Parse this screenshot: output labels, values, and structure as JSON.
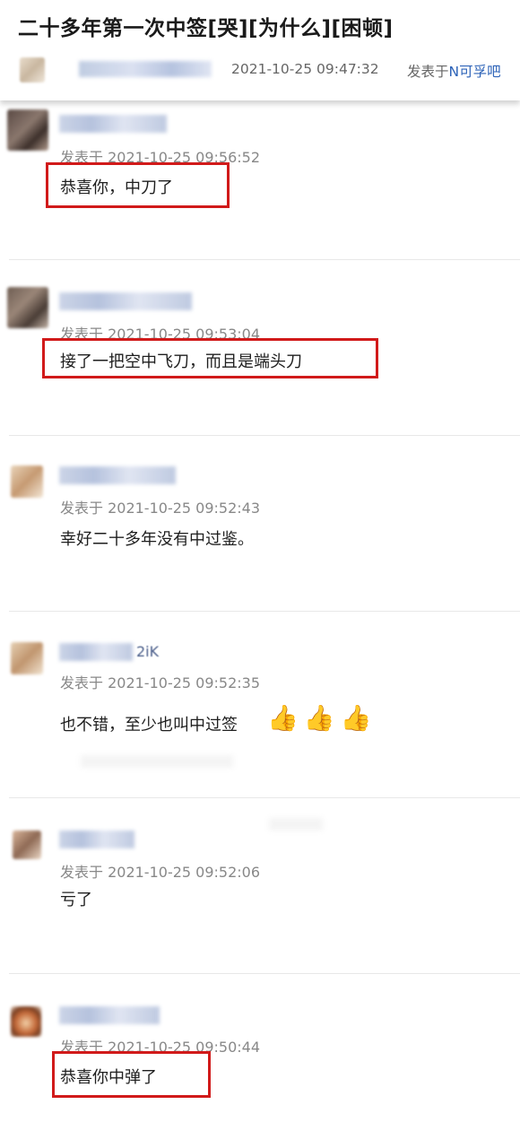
{
  "post": {
    "title": "二十多年第一次中签[哭][为什么][困顿]",
    "time": "2021-10-25 09:47:32",
    "posted_in_prefix": "发表于",
    "forum": "N可孚吧"
  },
  "comments": [
    {
      "name_tail": "",
      "time": "发表于 2021-10-25 09:56:52",
      "text": "恭喜你，中刀了",
      "highlighted": true
    },
    {
      "name_tail": "",
      "time": "发表于 2021-10-25 09:53:04",
      "text": "接了一把空中飞刀，而且是端头刀",
      "highlighted": true
    },
    {
      "name_tail": "",
      "time": "发表于 2021-10-25 09:52:43",
      "text": "幸好二十多年没有中过鉴。",
      "highlighted": false
    },
    {
      "name_tail": "2iK",
      "time": "发表于 2021-10-25 09:52:35",
      "text": "也不错，至少也叫中过签",
      "thumbs": "👍👍👍",
      "highlighted": false
    },
    {
      "name_tail": "",
      "time": "发表于 2021-10-25 09:52:06",
      "text": "亏了",
      "highlighted": false
    },
    {
      "name_tail": "",
      "time": "发表于 2021-10-25 09:50:44",
      "text": "恭喜你中弹了",
      "highlighted": true
    }
  ],
  "colors": {
    "highlight": "#d11a1a",
    "link": "#2d63b8"
  },
  "icons": {
    "reaction": "thumbs-up-icon"
  }
}
